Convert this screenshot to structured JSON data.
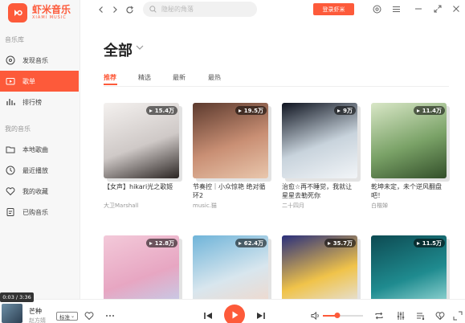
{
  "app": {
    "name_cn": "虾米音乐",
    "name_en": "XIAMI MUSIC",
    "brand_color": "#fd5a3a"
  },
  "sidebar": {
    "section_library": "音乐库",
    "section_mine": "我的音乐",
    "items": [
      {
        "label": "发现音乐",
        "icon": "disc-icon",
        "active": false
      },
      {
        "label": "歌单",
        "icon": "playlist-icon",
        "active": true
      },
      {
        "label": "排行榜",
        "icon": "chart-icon",
        "active": false
      },
      {
        "label": "本地歌曲",
        "icon": "folder-icon",
        "active": false
      },
      {
        "label": "最近播放",
        "icon": "clock-icon",
        "active": false
      },
      {
        "label": "我的收藏",
        "icon": "heart-icon",
        "active": false
      },
      {
        "label": "已购音乐",
        "icon": "purchase-icon",
        "active": false
      }
    ]
  },
  "topbar": {
    "search_placeholder": "隐秘的角落",
    "login_label": "登录虾米"
  },
  "main": {
    "title": "全部",
    "tabs": [
      {
        "label": "推荐",
        "active": true
      },
      {
        "label": "精选",
        "active": false
      },
      {
        "label": "最新",
        "active": false
      },
      {
        "label": "最热",
        "active": false
      }
    ],
    "playlists": [
      {
        "count": "15.4万",
        "title": "【女声】hikari光之歌姬",
        "author": "大卫Marshall",
        "colors": [
          "#f4f1ef",
          "#cfc9c7",
          "#2b2523"
        ]
      },
      {
        "count": "19.5万",
        "title": "节奏控｜小众惊艳 绝对循环2",
        "author": "music.猫",
        "colors": [
          "#5c3a2e",
          "#c98f74",
          "#e9c7ad"
        ]
      },
      {
        "count": "9万",
        "title": "治愈☆再不睡觉，我就让星星去勒死你",
        "author": "二十四月",
        "colors": [
          "#0f1420",
          "#c8d3dc",
          "#f2f5f8"
        ]
      },
      {
        "count": "11.4万",
        "title": "乾坤未定，未个逆风翻盘吧！",
        "author": "白楷婵",
        "colors": [
          "#d9e7c7",
          "#7aa267",
          "#334f2a"
        ]
      },
      {
        "count": "12.8万",
        "title": "",
        "author": "",
        "colors": [
          "#f3c9d9",
          "#e7a6c2",
          "#bfd3ef"
        ]
      },
      {
        "count": "62.4万",
        "title": "",
        "author": "",
        "colors": [
          "#6fb4d9",
          "#d8e6ee",
          "#f4d6c6"
        ]
      },
      {
        "count": "35.7万",
        "title": "",
        "author": "",
        "colors": [
          "#2a2f7c",
          "#f0c34a",
          "#e3e7f6"
        ]
      },
      {
        "count": "11.5万",
        "title": "",
        "author": "",
        "colors": [
          "#0d4a52",
          "#1f8b8f",
          "#a9e3e0"
        ]
      }
    ]
  },
  "player": {
    "elapsed": "0:03 / 3:36",
    "song_title": "芒种",
    "artist": "赵方婧",
    "quality": "标准",
    "progress": 0.014,
    "volume": 0.35
  }
}
